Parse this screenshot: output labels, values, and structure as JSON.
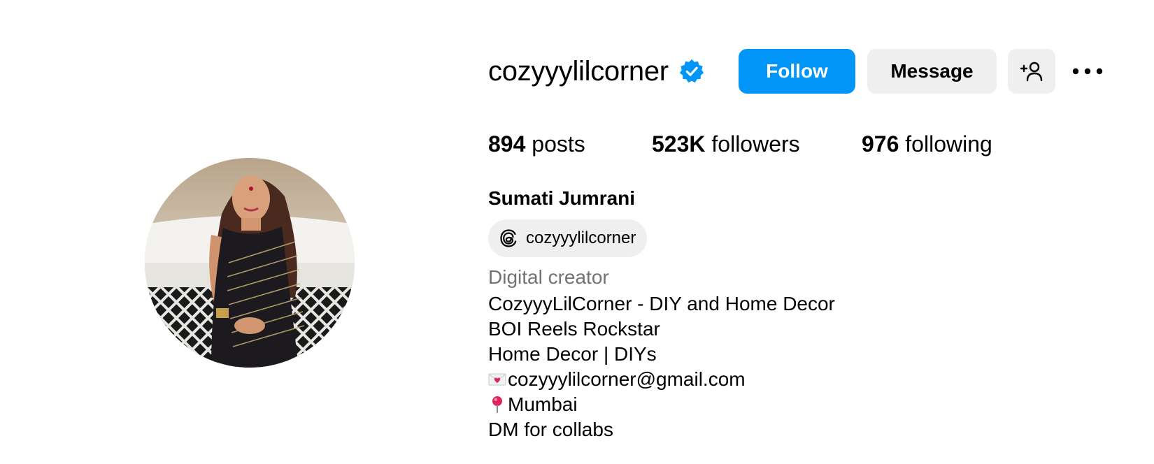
{
  "profile": {
    "username": "cozyyylilcorner",
    "display_name": "Sumati Jumrani",
    "verified_icon": "verified-badge-icon",
    "avatar_icon": "profile-photo",
    "threads_handle": "cozyyylilcorner",
    "category": "Digital creator"
  },
  "actions": {
    "follow_label": "Follow",
    "message_label": "Message",
    "add_user_icon": "add-user-icon",
    "more_icon": "more-options-icon"
  },
  "stats": {
    "posts_count": "894",
    "posts_label": "posts",
    "followers_count": "523K",
    "followers_label": "followers",
    "following_count": "976",
    "following_label": "following"
  },
  "bio": {
    "line1": "CozyyyLilCorner - DIY and Home Decor",
    "line2": "BOI Reels Rockstar",
    "line3": "Home Decor | DIYs",
    "email": "cozyyylilcorner@gmail.com",
    "email_icon": "love-letter-icon",
    "location": "Mumbai",
    "location_icon": "pushpin-icon",
    "line6": "DM for collabs"
  },
  "colors": {
    "follow_blue": "#0095f6",
    "button_gray": "#efefef",
    "category_gray": "#737373",
    "verified_blue": "#0095f6"
  }
}
